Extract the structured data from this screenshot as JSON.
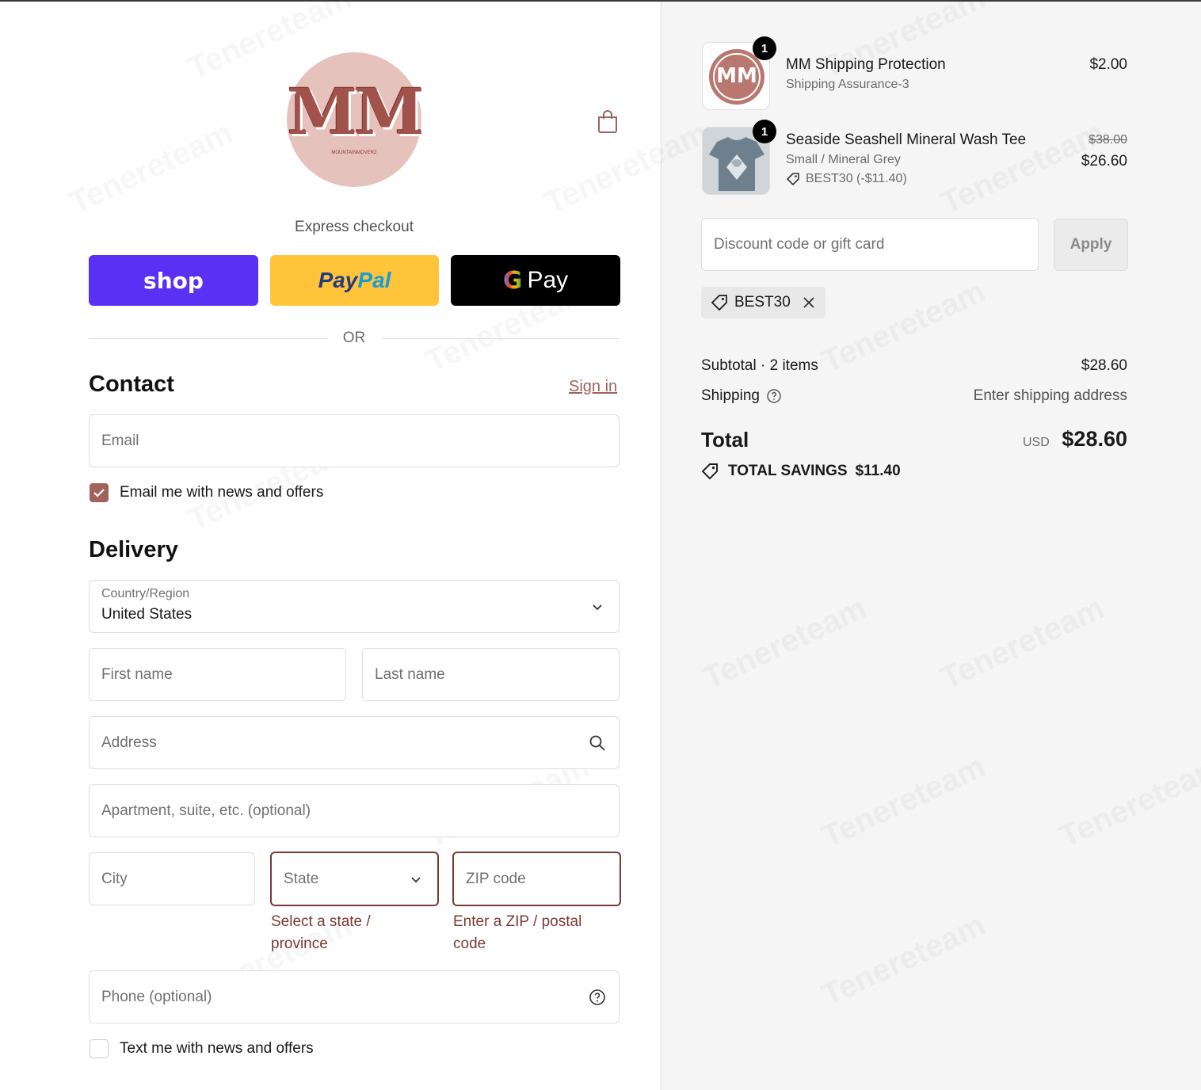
{
  "brand": {
    "logo_text": "MM",
    "logo_subtext": "MOUNTAINMOVERZ",
    "watermark": "Tenereteam"
  },
  "express": {
    "title": "Express checkout",
    "shop_label": "shop",
    "paypal_a": "Pay",
    "paypal_b": "Pal",
    "gpay_g": "G",
    "gpay_label": "Pay",
    "or": "OR"
  },
  "contact": {
    "title": "Contact",
    "sign_in": "Sign in",
    "email_placeholder": "Email",
    "newsletter_label": "Email me with news and offers",
    "newsletter_checked": true
  },
  "delivery": {
    "title": "Delivery",
    "country_label": "Country/Region",
    "country_value": "United States",
    "first_name": "First name",
    "last_name": "Last name",
    "address": "Address",
    "apartment": "Apartment, suite, etc. (optional)",
    "city": "City",
    "state": "State",
    "zip": "ZIP code",
    "state_error_1": "Select a state /",
    "state_error_2": "province",
    "zip_error_1": "Enter a ZIP / postal",
    "zip_error_2": "code",
    "phone": "Phone (optional)",
    "sms_label": "Text me with news and offers",
    "sms_checked": false
  },
  "cart": {
    "items": [
      {
        "qty": "1",
        "name": "MM Shipping Protection",
        "variant": "Shipping Assurance-3",
        "price": "$2.00",
        "thumb_text": "MM"
      },
      {
        "qty": "1",
        "name": "Seaside Seashell Mineral Wash Tee",
        "variant": "Small / Mineral Grey",
        "discount": "BEST30 (-$11.40)",
        "old_price": "$38.00",
        "price": "$26.60"
      }
    ],
    "discount_placeholder": "Discount code or gift card",
    "apply_label": "Apply",
    "applied_code": "BEST30",
    "subtotal_label": "Subtotal · 2 items",
    "subtotal_value": "$28.60",
    "shipping_label": "Shipping",
    "shipping_value": "Enter shipping address",
    "total_label": "Total",
    "currency": "USD",
    "total_value": "$28.60",
    "savings_label": "TOTAL SAVINGS",
    "savings_value": "$11.40"
  },
  "colors": {
    "accent": "#a1625b",
    "error": "#7a3a34",
    "shop": "#5a31f4",
    "paypal": "#ffc439"
  }
}
